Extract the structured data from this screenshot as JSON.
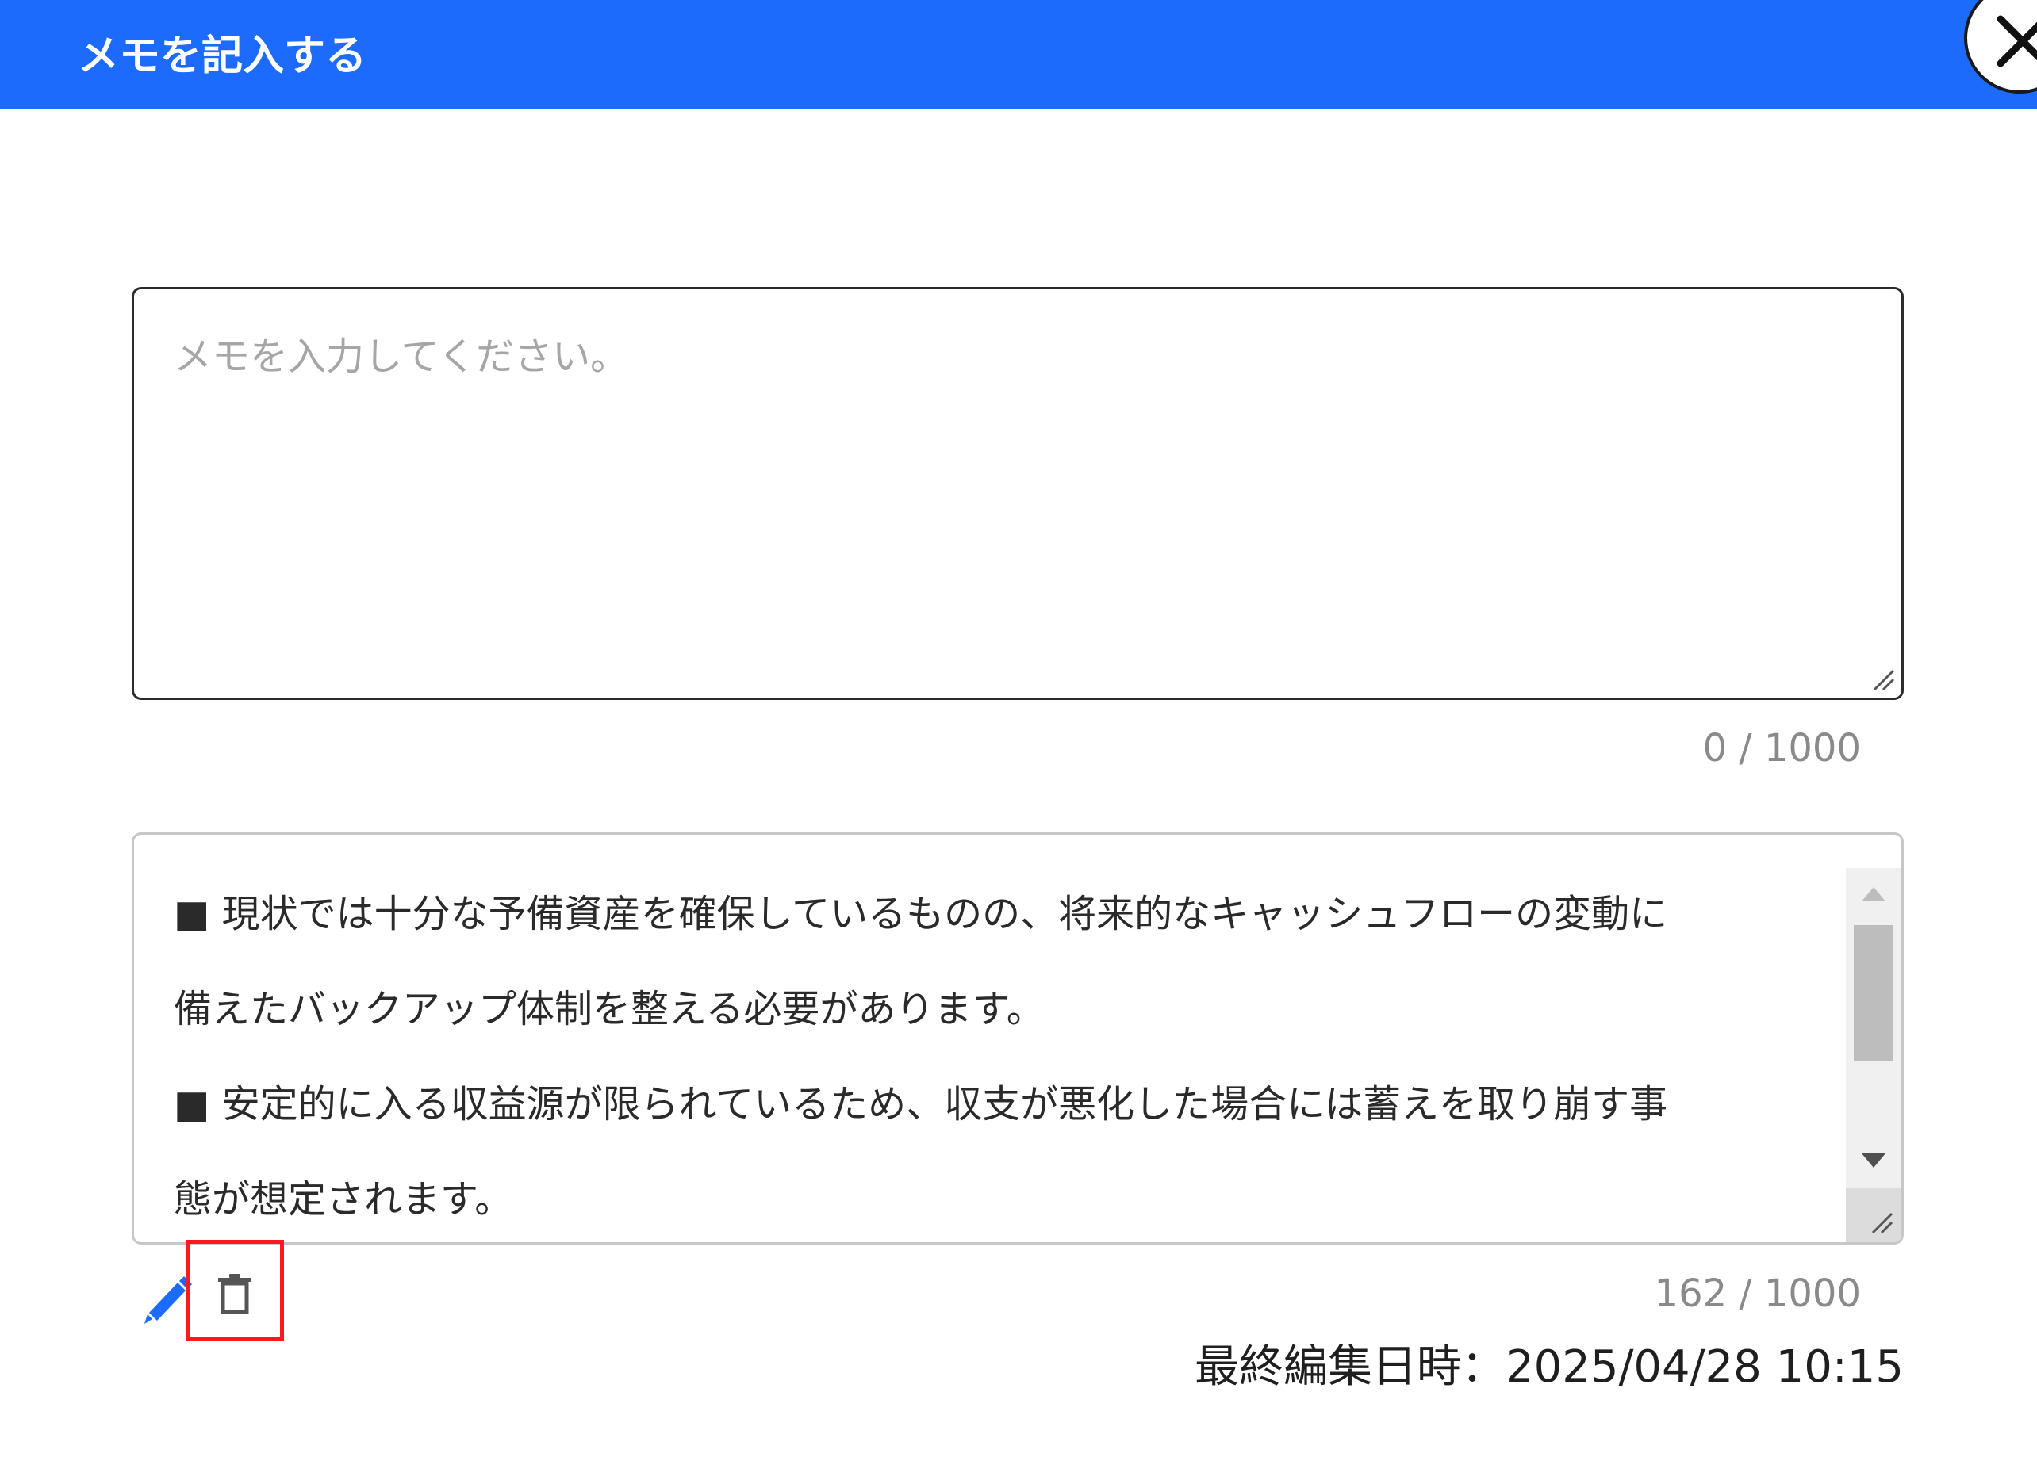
{
  "modal": {
    "title": "メモを記入する",
    "close_icon": "close-icon",
    "header_color": "#1d6bfd"
  },
  "memo_input": {
    "value": "",
    "placeholder": "メモを入力してください。",
    "count": "0 / 1000"
  },
  "saved_memo": {
    "lines": [
      "■ 現状では十分な予備資産を確保しているものの、将来的なキャッシュフローの変動に",
      "備えたバックアップ体制を整える必要があります。",
      "■ 安定的に入る収益源が限られているため、収支が悪化した場合には蓄えを取り崩す事",
      "態が想定されます。"
    ],
    "count": "162 / 1000",
    "edit_icon": "pencil-icon",
    "delete_icon": "trash-icon",
    "last_edited": "最終編集日時：2025/04/28 10:15",
    "accent_color": "#1d6bfd",
    "highlight_color": "#ff1a1a"
  }
}
